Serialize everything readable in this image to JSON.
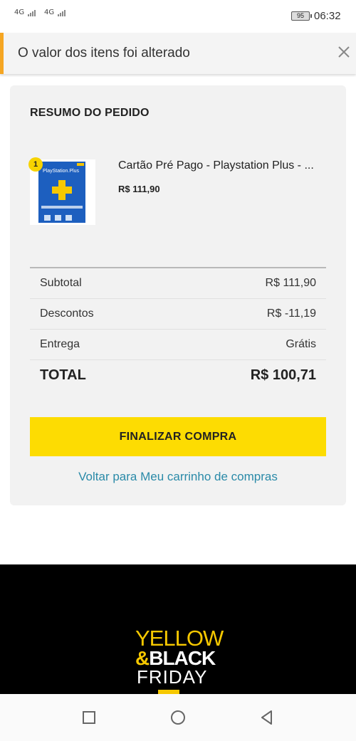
{
  "status_bar": {
    "signal1": "4G",
    "signal2": "4G",
    "battery": "95",
    "time": "06:32"
  },
  "alert": {
    "message": "O valor dos itens foi alterado",
    "close_icon": "close-icon"
  },
  "summary": {
    "title": "RESUMO DO PEDIDO",
    "item": {
      "quantity": "1",
      "name": "Cartão Pré Pago - Playstation Plus - ...",
      "price": "R$ 111,90",
      "image_caption": "PlayStation.Plus"
    },
    "rows": [
      {
        "label": "Subtotal",
        "value": "R$ 111,90"
      },
      {
        "label": "Descontos",
        "value": "R$ -11,19"
      },
      {
        "label": "Entrega",
        "value": "Grátis"
      }
    ],
    "total": {
      "label": "TOTAL",
      "value": "R$ 100,71"
    },
    "finalize_label": "FINALIZAR COMPRA",
    "back_link": "Voltar para Meu carrinho de compras"
  },
  "banner": {
    "line1": "YELLOW",
    "line2_amp": "&",
    "line2": "BLACK",
    "line3": "FRIDAY"
  },
  "colors": {
    "accent_yellow": "#fddc02",
    "alert_border": "#f5a623",
    "link": "#2a8aa8"
  },
  "nav_bar": {
    "icons": [
      "recent-apps-icon",
      "home-icon",
      "back-icon"
    ]
  }
}
